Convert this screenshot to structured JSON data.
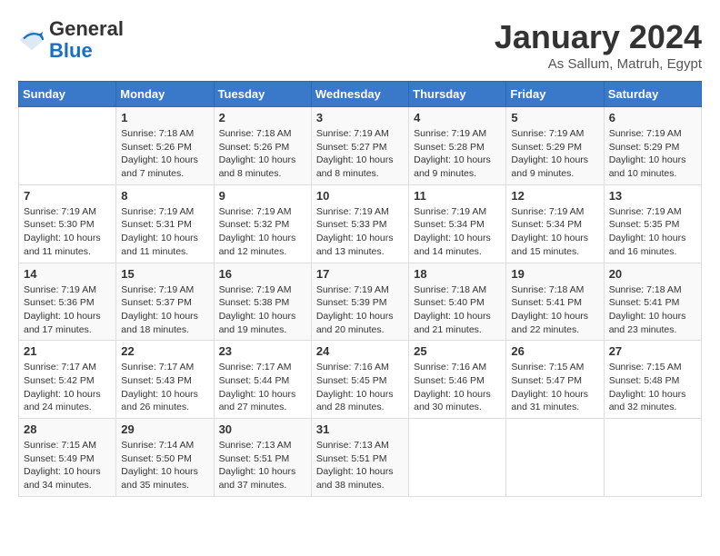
{
  "header": {
    "logo": {
      "line1": "General",
      "line2": "Blue"
    },
    "title": "January 2024",
    "subtitle": "As Sallum, Matruh, Egypt"
  },
  "days_of_week": [
    "Sunday",
    "Monday",
    "Tuesday",
    "Wednesday",
    "Thursday",
    "Friday",
    "Saturday"
  ],
  "weeks": [
    [
      null,
      {
        "day": 1,
        "sunrise": "7:18 AM",
        "sunset": "5:26 PM",
        "daylight": "10 hours and 7 minutes."
      },
      {
        "day": 2,
        "sunrise": "7:18 AM",
        "sunset": "5:26 PM",
        "daylight": "10 hours and 8 minutes."
      },
      {
        "day": 3,
        "sunrise": "7:19 AM",
        "sunset": "5:27 PM",
        "daylight": "10 hours and 8 minutes."
      },
      {
        "day": 4,
        "sunrise": "7:19 AM",
        "sunset": "5:28 PM",
        "daylight": "10 hours and 9 minutes."
      },
      {
        "day": 5,
        "sunrise": "7:19 AM",
        "sunset": "5:29 PM",
        "daylight": "10 hours and 9 minutes."
      },
      {
        "day": 6,
        "sunrise": "7:19 AM",
        "sunset": "5:29 PM",
        "daylight": "10 hours and 10 minutes."
      }
    ],
    [
      {
        "day": 7,
        "sunrise": "7:19 AM",
        "sunset": "5:30 PM",
        "daylight": "10 hours and 11 minutes."
      },
      {
        "day": 8,
        "sunrise": "7:19 AM",
        "sunset": "5:31 PM",
        "daylight": "10 hours and 11 minutes."
      },
      {
        "day": 9,
        "sunrise": "7:19 AM",
        "sunset": "5:32 PM",
        "daylight": "10 hours and 12 minutes."
      },
      {
        "day": 10,
        "sunrise": "7:19 AM",
        "sunset": "5:33 PM",
        "daylight": "10 hours and 13 minutes."
      },
      {
        "day": 11,
        "sunrise": "7:19 AM",
        "sunset": "5:34 PM",
        "daylight": "10 hours and 14 minutes."
      },
      {
        "day": 12,
        "sunrise": "7:19 AM",
        "sunset": "5:34 PM",
        "daylight": "10 hours and 15 minutes."
      },
      {
        "day": 13,
        "sunrise": "7:19 AM",
        "sunset": "5:35 PM",
        "daylight": "10 hours and 16 minutes."
      }
    ],
    [
      {
        "day": 14,
        "sunrise": "7:19 AM",
        "sunset": "5:36 PM",
        "daylight": "10 hours and 17 minutes."
      },
      {
        "day": 15,
        "sunrise": "7:19 AM",
        "sunset": "5:37 PM",
        "daylight": "10 hours and 18 minutes."
      },
      {
        "day": 16,
        "sunrise": "7:19 AM",
        "sunset": "5:38 PM",
        "daylight": "10 hours and 19 minutes."
      },
      {
        "day": 17,
        "sunrise": "7:19 AM",
        "sunset": "5:39 PM",
        "daylight": "10 hours and 20 minutes."
      },
      {
        "day": 18,
        "sunrise": "7:18 AM",
        "sunset": "5:40 PM",
        "daylight": "10 hours and 21 minutes."
      },
      {
        "day": 19,
        "sunrise": "7:18 AM",
        "sunset": "5:41 PM",
        "daylight": "10 hours and 22 minutes."
      },
      {
        "day": 20,
        "sunrise": "7:18 AM",
        "sunset": "5:41 PM",
        "daylight": "10 hours and 23 minutes."
      }
    ],
    [
      {
        "day": 21,
        "sunrise": "7:17 AM",
        "sunset": "5:42 PM",
        "daylight": "10 hours and 24 minutes."
      },
      {
        "day": 22,
        "sunrise": "7:17 AM",
        "sunset": "5:43 PM",
        "daylight": "10 hours and 26 minutes."
      },
      {
        "day": 23,
        "sunrise": "7:17 AM",
        "sunset": "5:44 PM",
        "daylight": "10 hours and 27 minutes."
      },
      {
        "day": 24,
        "sunrise": "7:16 AM",
        "sunset": "5:45 PM",
        "daylight": "10 hours and 28 minutes."
      },
      {
        "day": 25,
        "sunrise": "7:16 AM",
        "sunset": "5:46 PM",
        "daylight": "10 hours and 30 minutes."
      },
      {
        "day": 26,
        "sunrise": "7:15 AM",
        "sunset": "5:47 PM",
        "daylight": "10 hours and 31 minutes."
      },
      {
        "day": 27,
        "sunrise": "7:15 AM",
        "sunset": "5:48 PM",
        "daylight": "10 hours and 32 minutes."
      }
    ],
    [
      {
        "day": 28,
        "sunrise": "7:15 AM",
        "sunset": "5:49 PM",
        "daylight": "10 hours and 34 minutes."
      },
      {
        "day": 29,
        "sunrise": "7:14 AM",
        "sunset": "5:50 PM",
        "daylight": "10 hours and 35 minutes."
      },
      {
        "day": 30,
        "sunrise": "7:13 AM",
        "sunset": "5:51 PM",
        "daylight": "10 hours and 37 minutes."
      },
      {
        "day": 31,
        "sunrise": "7:13 AM",
        "sunset": "5:51 PM",
        "daylight": "10 hours and 38 minutes."
      },
      null,
      null,
      null
    ]
  ]
}
